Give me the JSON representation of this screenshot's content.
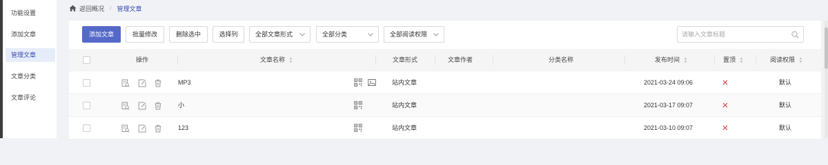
{
  "sidebar": {
    "items": [
      {
        "label": "功能设置",
        "active": false
      },
      {
        "label": "添加文章",
        "active": false
      },
      {
        "label": "管理文章",
        "active": true
      },
      {
        "label": "文章分类",
        "active": false
      },
      {
        "label": "文章评论",
        "active": false
      }
    ]
  },
  "breadcrumb": {
    "back": "返回概况",
    "separator": "/",
    "current": "管理文章"
  },
  "toolbar": {
    "add": "添加文章",
    "batch_edit": "批量修改",
    "delete_selected": "删除选中",
    "select_columns": "选择列",
    "filter_form": "全部文章形式",
    "filter_category": "全部分类",
    "filter_permission": "全部阅读权限",
    "search_placeholder": "请输入文章标题"
  },
  "table": {
    "headers": {
      "actions": "操作",
      "name": "文章名称",
      "form": "文章形式",
      "author": "文章作者",
      "category": "分类名称",
      "date": "发布时间",
      "top": "置顶",
      "permission": "阅读权限"
    },
    "rows": [
      {
        "name": "MP3",
        "has_image": true,
        "form": "站内文章",
        "author": "",
        "category": "",
        "date": "2021-03-24 09:06",
        "top": "✕",
        "permission": "默认"
      },
      {
        "name": "小",
        "has_image": false,
        "form": "站内文章",
        "author": "",
        "category": "",
        "date": "2021-03-17 09:07",
        "top": "✕",
        "permission": "默认"
      },
      {
        "name": "123",
        "has_image": false,
        "form": "站内文章",
        "author": "",
        "category": "",
        "date": "2021-03-10 09:07",
        "top": "✕",
        "permission": "默认"
      }
    ]
  },
  "colors": {
    "primary": "#5569c8",
    "active_bg": "#e7ecfb",
    "danger": "#e0404a"
  },
  "icons": [
    "home-icon",
    "chevron-down-icon",
    "search-icon",
    "sort-icon",
    "preview-icon",
    "edit-icon",
    "trash-icon",
    "qrcode-icon",
    "image-icon",
    "close-icon"
  ]
}
